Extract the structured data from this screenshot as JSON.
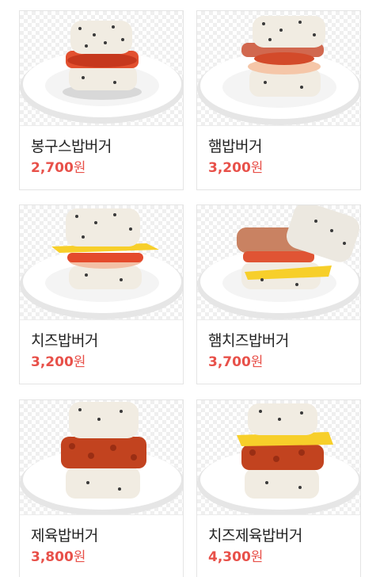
{
  "menu": {
    "items": [
      {
        "name": "봉구스밥버거",
        "price": "2,700",
        "currency": "원",
        "image": "bonggus-rice-burger"
      },
      {
        "name": "햄밥버거",
        "price": "3,200",
        "currency": "원",
        "image": "ham-rice-burger"
      },
      {
        "name": "치즈밥버거",
        "price": "3,200",
        "currency": "원",
        "image": "cheese-rice-burger"
      },
      {
        "name": "햄치즈밥버거",
        "price": "3,700",
        "currency": "원",
        "image": "ham-cheese-rice-burger"
      },
      {
        "name": "제육밥버거",
        "price": "3,800",
        "currency": "원",
        "image": "spicy-pork-rice-burger"
      },
      {
        "name": "치즈제육밥버거",
        "price": "4,300",
        "currency": "원",
        "image": "cheese-spicy-pork-rice-burger"
      }
    ]
  },
  "colors": {
    "price": "#e8514a",
    "name": "#222222",
    "border": "#e4e4e4"
  }
}
